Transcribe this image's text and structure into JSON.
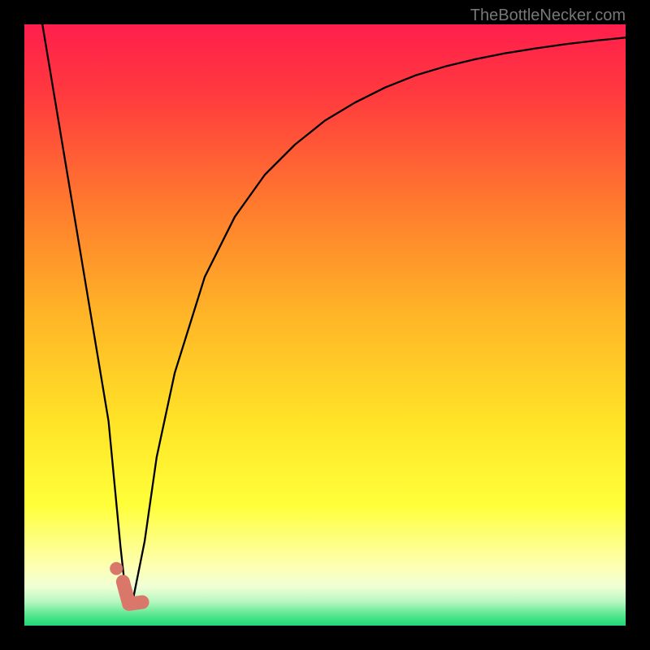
{
  "watermark": "TheBottleNecker.com",
  "chart_data": {
    "type": "line",
    "title": "",
    "xlabel": "",
    "ylabel": "",
    "xlim": [
      0,
      100
    ],
    "ylim": [
      0,
      100
    ],
    "notes": "Bottleneck curve: steep V-shaped minimum near x≈17 then rising saturating curve. Values are relative percentages read off pixel positions (no numeric axes shown).",
    "series": [
      {
        "name": "bottleneck-curve",
        "x": [
          3,
          5,
          8,
          11,
          14,
          16,
          17,
          18,
          20,
          22,
          25,
          30,
          35,
          40,
          45,
          50,
          55,
          60,
          65,
          70,
          75,
          80,
          85,
          90,
          95,
          100
        ],
        "y": [
          100,
          88,
          70,
          52,
          34,
          13,
          4,
          4,
          14,
          28,
          42,
          58,
          68,
          75,
          80,
          84,
          87,
          89.5,
          91.5,
          93,
          94.2,
          95.2,
          96,
          96.7,
          97.3,
          97.8
        ]
      }
    ],
    "gradient_bands": [
      {
        "stop": 0.0,
        "color": "#ff1e4c"
      },
      {
        "stop": 0.12,
        "color": "#ff3b3e"
      },
      {
        "stop": 0.3,
        "color": "#ff7a2e"
      },
      {
        "stop": 0.48,
        "color": "#ffb427"
      },
      {
        "stop": 0.66,
        "color": "#ffe327"
      },
      {
        "stop": 0.8,
        "color": "#ffff3a"
      },
      {
        "stop": 0.9,
        "color": "#fdffb0"
      },
      {
        "stop": 0.935,
        "color": "#f0ffd6"
      },
      {
        "stop": 0.96,
        "color": "#b7f7c0"
      },
      {
        "stop": 0.985,
        "color": "#4de58a"
      },
      {
        "stop": 1.0,
        "color": "#1fd877"
      }
    ],
    "marker": {
      "color": "#d9786a",
      "dot": {
        "x": 15.3,
        "y": 9.5
      },
      "elbow": [
        {
          "x": 16.4,
          "y": 7.3
        },
        {
          "x": 17.4,
          "y": 3.6
        },
        {
          "x": 19.6,
          "y": 3.9
        }
      ]
    }
  }
}
